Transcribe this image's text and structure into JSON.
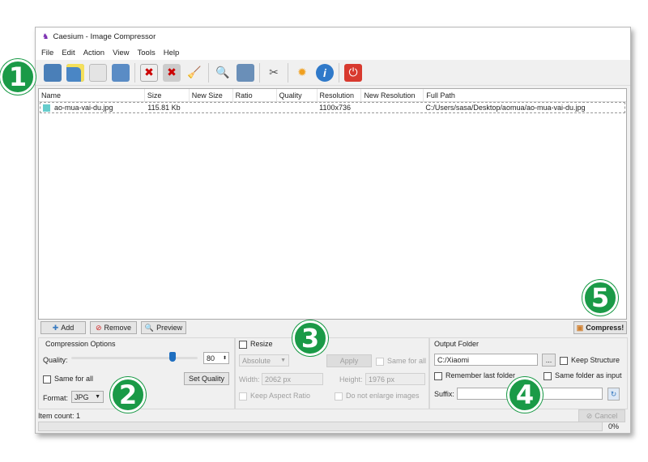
{
  "window": {
    "title": "Caesium - Image Compressor"
  },
  "menu": [
    "File",
    "Edit",
    "Action",
    "View",
    "Tools",
    "Help"
  ],
  "toolbar": [
    "open-files-icon",
    "open-folder-icon",
    "save-icon",
    "export-icon",
    "remove-file-icon",
    "clear-list-icon",
    "clean-icon",
    "preview-icon",
    "compare-icon",
    "settings-icon",
    "update-icon",
    "info-icon",
    "quit-icon"
  ],
  "table": {
    "columns": [
      "Name",
      "Size",
      "New Size",
      "Ratio",
      "Quality",
      "Resolution",
      "New Resolution",
      "Full Path"
    ],
    "rows": [
      {
        "name": "ao-mua-vai-du.jpg",
        "size": "115.81 Kb",
        "new_size": "",
        "ratio": "",
        "quality": "",
        "resolution": "1100x736",
        "new_resolution": "",
        "path": "C:/Users/sasa/Desktop/aomua/ao-mua-vai-du.jpg"
      }
    ]
  },
  "buttons": {
    "add": "Add",
    "remove": "Remove",
    "preview": "Preview",
    "compress": "Compress!",
    "cancel": "Cancel",
    "apply": "Apply",
    "set_quality": "Set Quality",
    "browse": "..."
  },
  "compression": {
    "title": "Compression Options",
    "quality_label": "Quality:",
    "quality": "80",
    "quality_percent": 80,
    "same_for_all": "Same for all",
    "format_label": "Format:",
    "format": "JPG"
  },
  "resize": {
    "title": "Resize",
    "mode": "Absolute",
    "same_for_all": "Same for all",
    "width_label": "Width:",
    "width": "2062 px",
    "height_label": "Height:",
    "height": "1976 px",
    "keep_aspect": "Keep Aspect Ratio",
    "no_enlarge": "Do not enlarge images"
  },
  "output": {
    "title": "Output Folder",
    "folder": "C:/Xiaomi",
    "keep_structure": "Keep Structure",
    "remember": "Remember last folder",
    "same_folder": "Same folder as input",
    "suffix_label": "Suffix:",
    "suffix": ""
  },
  "status": {
    "item_count": "Item count: 1",
    "progress": "0%"
  },
  "callouts": [
    "1",
    "2",
    "3",
    "4",
    "5"
  ],
  "colors": {
    "callout": "#1a9a47"
  }
}
